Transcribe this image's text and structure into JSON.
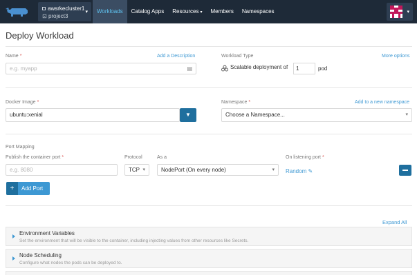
{
  "colors": {
    "topbar": "#1e2a38",
    "accent": "#3d98d3",
    "button_dark": "#1f6f9e",
    "required": "#d9534f"
  },
  "topbar": {
    "cluster": "awsrkecluster1",
    "project": "project3",
    "nav": [
      {
        "label": "Workloads",
        "active": true
      },
      {
        "label": "Catalog Apps"
      },
      {
        "label": "Resources",
        "caret": true
      },
      {
        "label": "Members"
      },
      {
        "label": "Namespaces"
      }
    ]
  },
  "page": {
    "title": "Deploy Workload"
  },
  "name_field": {
    "label": "Name",
    "required": "*",
    "link": "Add a Description",
    "placeholder": "e.g. myapp"
  },
  "workload_type": {
    "label": "Workload Type",
    "link": "More options",
    "text": "Scalable deployment of",
    "pods": "1",
    "unit": "pod"
  },
  "docker": {
    "label": "Docker Image",
    "required": "*",
    "value": "ubuntu:xenial"
  },
  "namespace": {
    "label": "Namespace",
    "required": "*",
    "link": "Add to a new namespace",
    "value": "Choose a Namespace..."
  },
  "ports": {
    "section_label": "Port Mapping",
    "publish_label": "Publish the container port",
    "required": "*",
    "publish_placeholder": "e.g. 8080",
    "protocol_label": "Protocol",
    "protocol_value": "TCP",
    "as_label": "As a",
    "as_value": "NodePort (On every node)",
    "listen_label": "On listening port",
    "listen_value": "Random",
    "add_label": "Add Port"
  },
  "sections": {
    "expand_all": "Expand All",
    "items": [
      {
        "title": "Environment Variables",
        "desc": "Set the environment that will be visible to the container, including injecting values from other resources like Secrets."
      },
      {
        "title": "Node Scheduling",
        "desc": "Configure what nodes the pods can be deployed to."
      }
    ]
  }
}
